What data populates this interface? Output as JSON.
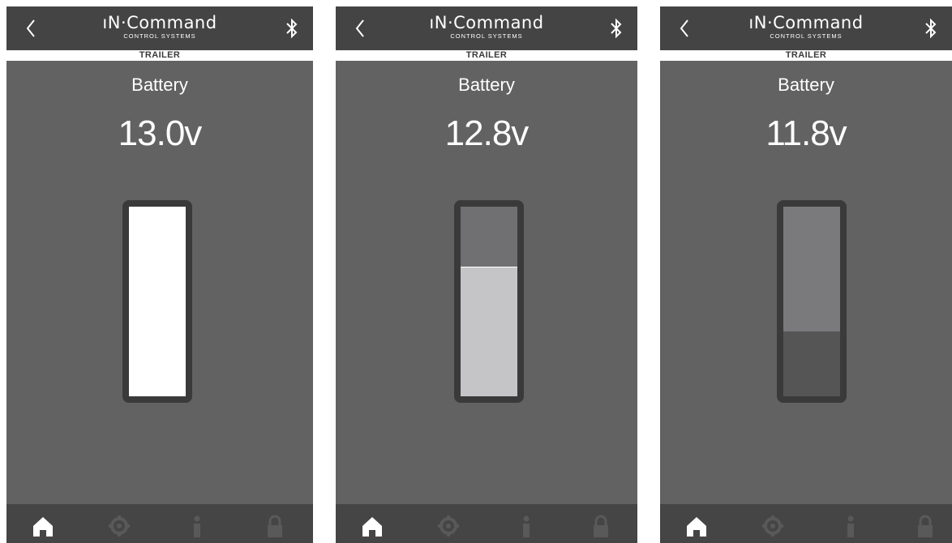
{
  "screens": [
    {
      "logo": {
        "main": "ıN·Command",
        "sub": "CONTROL SYSTEMS"
      },
      "tab": "TRAILER",
      "title": "Battery",
      "voltage": "13.0v",
      "gauge": {
        "fill_fraction": 1.0,
        "fill_color": "#ffffff",
        "empty_color": "#707072"
      }
    },
    {
      "logo": {
        "main": "ıN·Command",
        "sub": "CONTROL SYSTEMS"
      },
      "tab": "TRAILER",
      "title": "Battery",
      "voltage": "12.8v",
      "gauge": {
        "fill_fraction": 0.68,
        "fill_color": "#c5c5c7",
        "empty_color": "#707072"
      }
    },
    {
      "logo": {
        "main": "ıN·Command",
        "sub": "CONTROL SYSTEMS"
      },
      "tab": "TRAILER",
      "title": "Battery",
      "voltage": "11.8v",
      "gauge": {
        "fill_fraction": 0.34,
        "fill_color": "#555556",
        "empty_color": "#7a7a7c"
      }
    }
  ],
  "icons": {
    "back": "chevron-left-icon",
    "bluetooth": "bluetooth-icon",
    "nav": [
      "home-icon",
      "gear-icon",
      "info-icon",
      "lock-icon"
    ]
  },
  "colors": {
    "background": "#626263",
    "topbar": "#444445",
    "bottombar": "#454546",
    "nav_active": "#ffffff",
    "nav_inactive": "#59595a"
  }
}
